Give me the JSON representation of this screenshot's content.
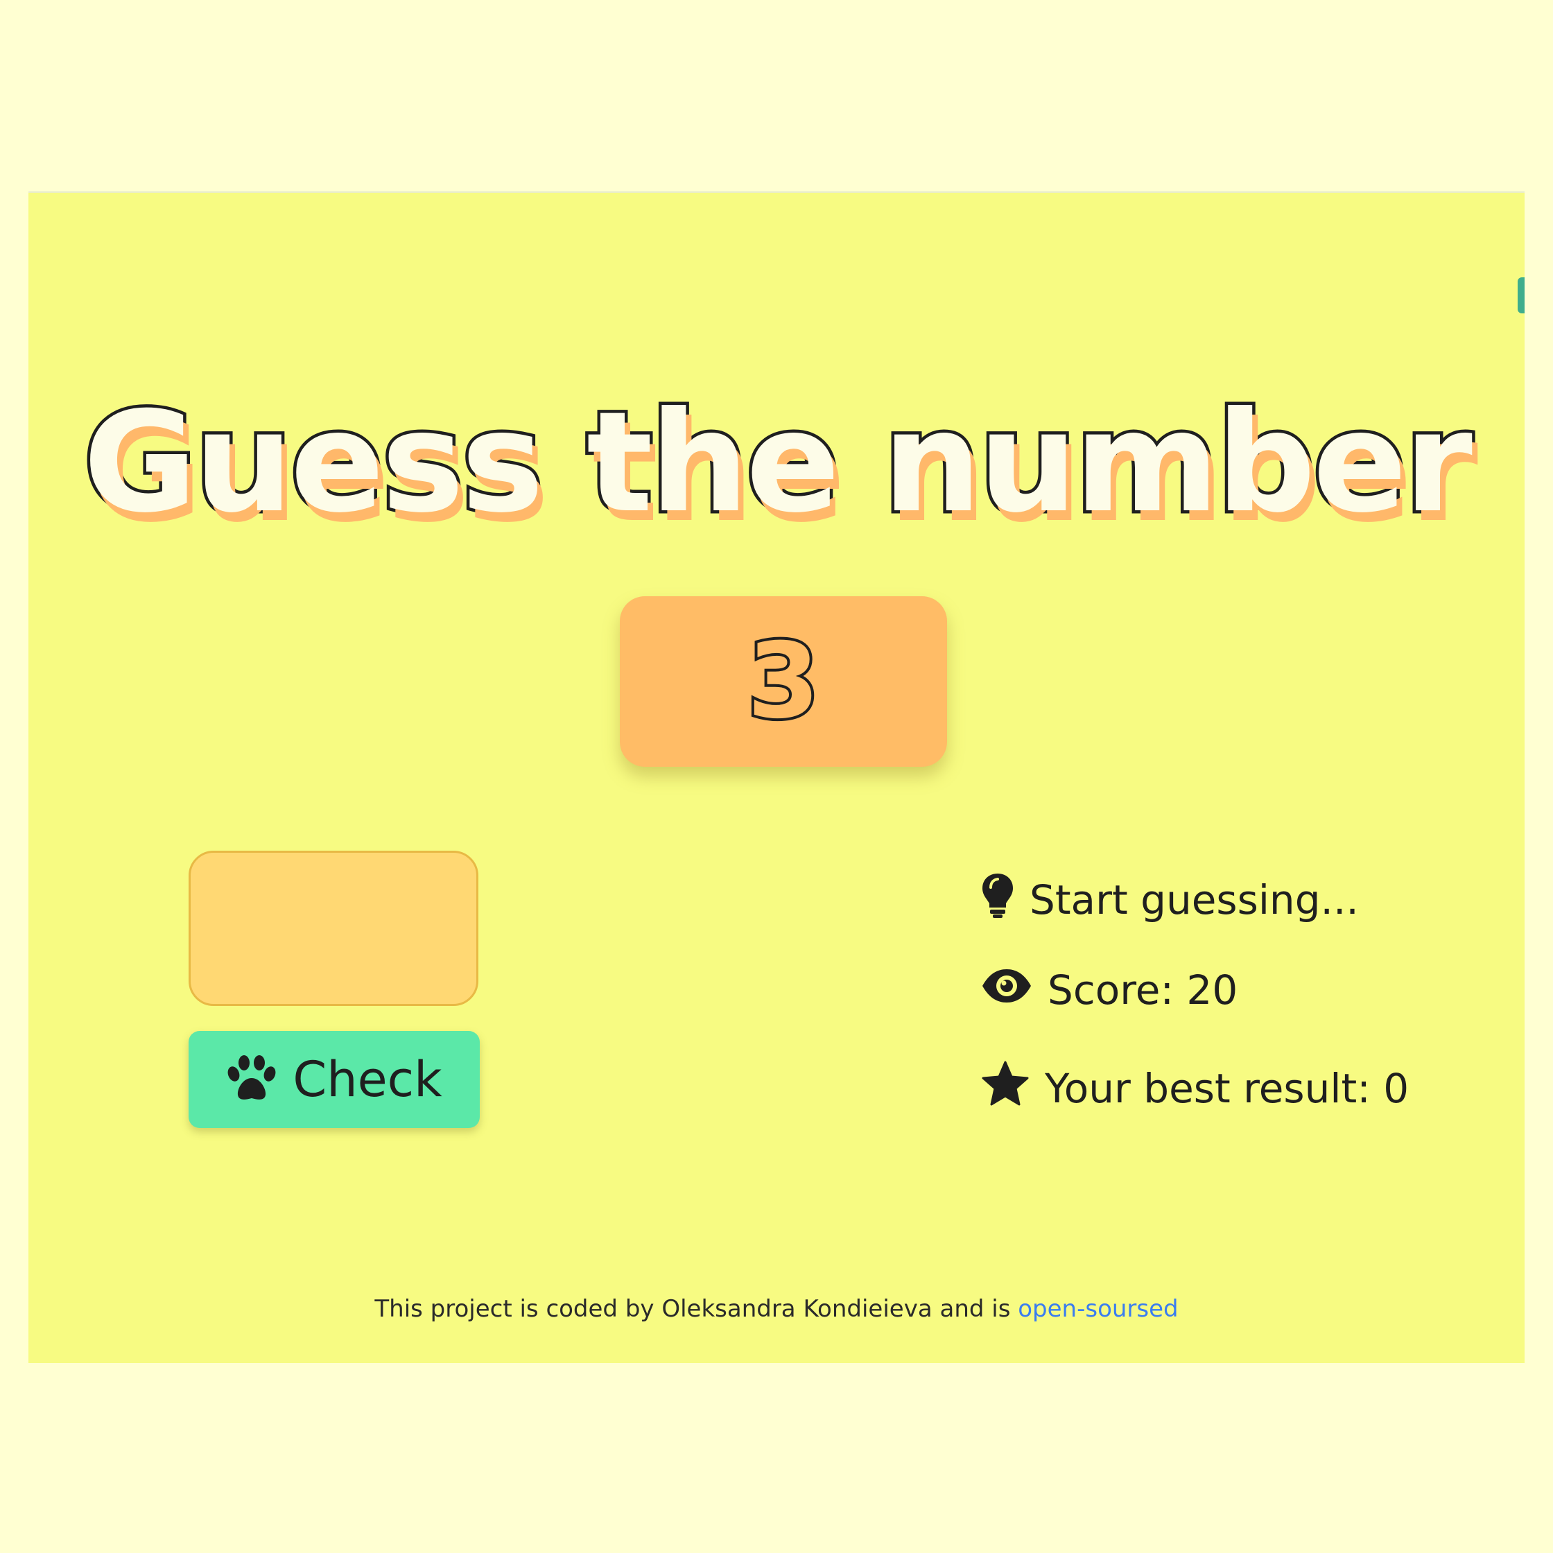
{
  "game": {
    "title": "Guess the number",
    "secret_display": "3",
    "guess_input": {
      "value": "",
      "placeholder": ""
    },
    "check_button": {
      "label": "Check",
      "icon": "paw-icon"
    },
    "message": {
      "text": "Start guessing...",
      "icon": "lightbulb-icon"
    },
    "score": {
      "text": "Score: 20",
      "icon": "eye-icon"
    },
    "best_result": {
      "text": "Your best result: 0",
      "icon": "star-icon"
    }
  },
  "footer": {
    "text": "This project is coded by Oleksandra Kondieieva and is ",
    "link_text": "open-soursed"
  },
  "colors": {
    "page_background": "#ffffd2",
    "card_background": "#f7fb82",
    "number_box": "#ffbc66",
    "input_background": "#ffd873",
    "check_button": "#5be8a8",
    "title_shadow": "#ffb86a",
    "link": "#3a7df0",
    "text": "#1f1f1f"
  }
}
